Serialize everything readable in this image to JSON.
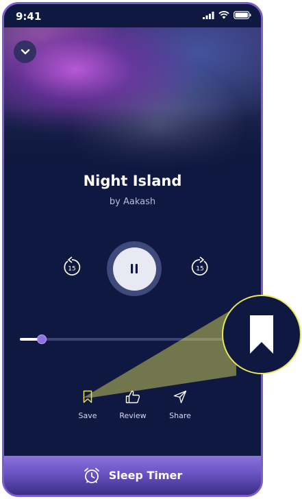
{
  "status": {
    "time": "9:41"
  },
  "track": {
    "title": "Night Island",
    "artist": "by Aakash",
    "progress": 0.1
  },
  "controls": {
    "rewind_seconds": "15",
    "forward_seconds": "15"
  },
  "actions": {
    "save": "Save",
    "review": "Review",
    "share": "Share"
  },
  "sleep_timer": {
    "label": "Sleep Timer"
  },
  "colors": {
    "background": "#0f1840",
    "accent": "#8b73e0",
    "highlight": "#e8e85a"
  }
}
